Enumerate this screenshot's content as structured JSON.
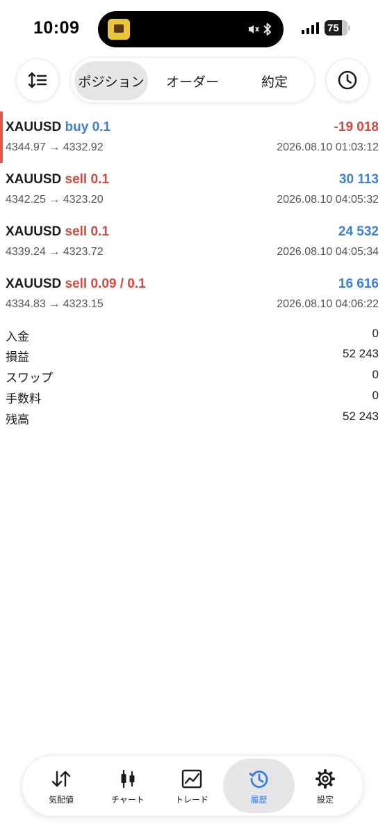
{
  "status_bar": {
    "time": "10:09",
    "battery": "75"
  },
  "toolbar": {
    "sort_icon": "sort-lines-icon",
    "history_icon": "clock-icon",
    "tabs": [
      {
        "label": "ポジション",
        "active": true
      },
      {
        "label": "オーダー",
        "active": false
      },
      {
        "label": "約定",
        "active": false
      }
    ]
  },
  "trades": [
    {
      "symbol": "XAUUSD",
      "side": "buy 0.1",
      "side_type": "buy",
      "pnl": "-19 018",
      "pnl_sign": "negative",
      "open": "4344.97",
      "close": "4332.92",
      "arrow": "→",
      "time": "2026.08.10 01:03:12"
    },
    {
      "symbol": "XAUUSD",
      "side": "sell 0.1",
      "side_type": "sell",
      "pnl": "30 113",
      "pnl_sign": "positive",
      "open": "4342.25",
      "close": "4323.20",
      "arrow": "→",
      "time": "2026.08.10 04:05:32"
    },
    {
      "symbol": "XAUUSD",
      "side": "sell 0.1",
      "side_type": "sell",
      "pnl": "24 532",
      "pnl_sign": "positive",
      "open": "4339.24",
      "close": "4323.72",
      "arrow": "→",
      "time": "2026.08.10 04:05:34"
    },
    {
      "symbol": "XAUUSD",
      "side": "sell 0.09 / 0.1",
      "side_type": "sell",
      "pnl": "16 616",
      "pnl_sign": "positive",
      "open": "4334.83",
      "close": "4323.15",
      "arrow": "→",
      "time": "2026.08.10 04:06:22"
    }
  ],
  "summary": [
    {
      "label": "入金",
      "value": "0"
    },
    {
      "label": "損益",
      "value": "52 243"
    },
    {
      "label": "スワップ",
      "value": "0"
    },
    {
      "label": "手数料",
      "value": "0"
    },
    {
      "label": "残高",
      "value": "52 243"
    }
  ],
  "tabbar": [
    {
      "label": "気配値",
      "icon": "arrows-up-down-icon",
      "active": false
    },
    {
      "label": "チャート",
      "icon": "candlestick-icon",
      "active": false
    },
    {
      "label": "トレード",
      "icon": "line-chart-icon",
      "active": false
    },
    {
      "label": "履歴",
      "icon": "history-icon",
      "active": true
    },
    {
      "label": "設定",
      "icon": "gear-icon",
      "active": false
    }
  ],
  "colors": {
    "buy_blue": "#3a7fdc",
    "sell_red": "#d9483e",
    "highlight_bar": "#e0584e",
    "active_bg": "#e6e6e8"
  }
}
